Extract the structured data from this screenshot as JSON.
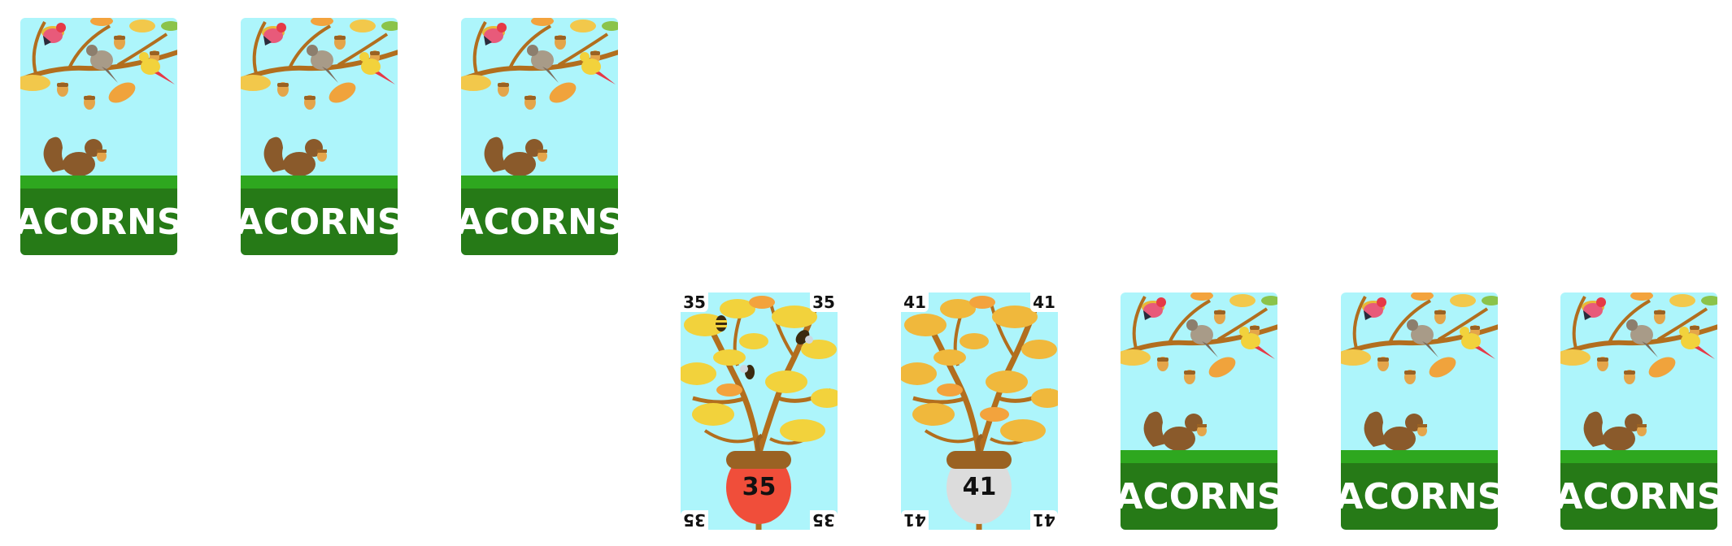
{
  "colors": {
    "sky": "#adf5fb",
    "grass": "#2ea71f",
    "label_bg": "#267a17",
    "branch": "#b26e1e",
    "acorn_red": "#f04e3a",
    "acorn_white": "#dcdcdc"
  },
  "deck": {
    "label": "ACORNS"
  },
  "hand_top": [
    {
      "label": "ACORNS"
    },
    {
      "label": "ACORNS"
    },
    {
      "label": "ACORNS"
    }
  ],
  "played": [
    {
      "value": "35",
      "acorn": "red",
      "bees": true
    },
    {
      "value": "41",
      "acorn": "white",
      "bees": false
    }
  ],
  "hand_bottom": [
    {
      "label": "ACORNS"
    },
    {
      "label": "ACORNS"
    },
    {
      "label": "ACORNS"
    }
  ]
}
